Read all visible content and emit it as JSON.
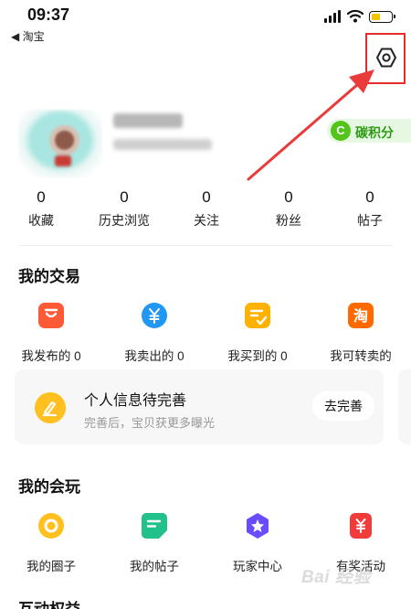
{
  "status_bar": {
    "time": "09:37",
    "back_app": "◀ 淘宝",
    "battery_color": "#f5c400"
  },
  "settings": {
    "icon": "hexagon-settings-icon",
    "highlight_color": "#e52d2d"
  },
  "carbon_badge": {
    "icon_letter": "C",
    "label": "碳积分",
    "color": "#52c41a"
  },
  "stats": [
    {
      "count": "0",
      "label": "收藏"
    },
    {
      "count": "0",
      "label": "历史浏览"
    },
    {
      "count": "0",
      "label": "关注"
    },
    {
      "count": "0",
      "label": "粉丝"
    },
    {
      "count": "0",
      "label": "帖子"
    }
  ],
  "trade": {
    "title": "我的交易",
    "items": [
      {
        "label": "我发布的 0",
        "icon": "shopping-bag-icon",
        "color": "#ff5a36"
      },
      {
        "label": "我卖出的 0",
        "icon": "yuan-coin-icon",
        "color": "#2196f3"
      },
      {
        "label": "我买到的 0",
        "icon": "check-note-icon",
        "color": "#ffb100"
      },
      {
        "label": "我可转卖的",
        "icon": "taobao-icon",
        "color": "#ff6a00"
      }
    ]
  },
  "info_card": {
    "title": "个人信息待完善",
    "subtitle": "完善后，宝贝获更多曝光",
    "button": "去完善",
    "icon": "pen-icon",
    "icon_color": "#ffc020"
  },
  "play": {
    "title": "我的会玩",
    "items": [
      {
        "label": "我的圈子",
        "icon": "circle-ring-icon",
        "color": "#ffc020"
      },
      {
        "label": "我的帖子",
        "icon": "post-note-icon",
        "color": "#22c08a"
      },
      {
        "label": "玩家中心",
        "icon": "star-badge-icon",
        "color": "#6a4cff"
      },
      {
        "label": "有奖活动",
        "icon": "reward-yuan-icon",
        "color": "#f23c3c"
      }
    ]
  },
  "next_section": {
    "title": "互动权益"
  },
  "watermark": {
    "text": "Bai 经验"
  }
}
